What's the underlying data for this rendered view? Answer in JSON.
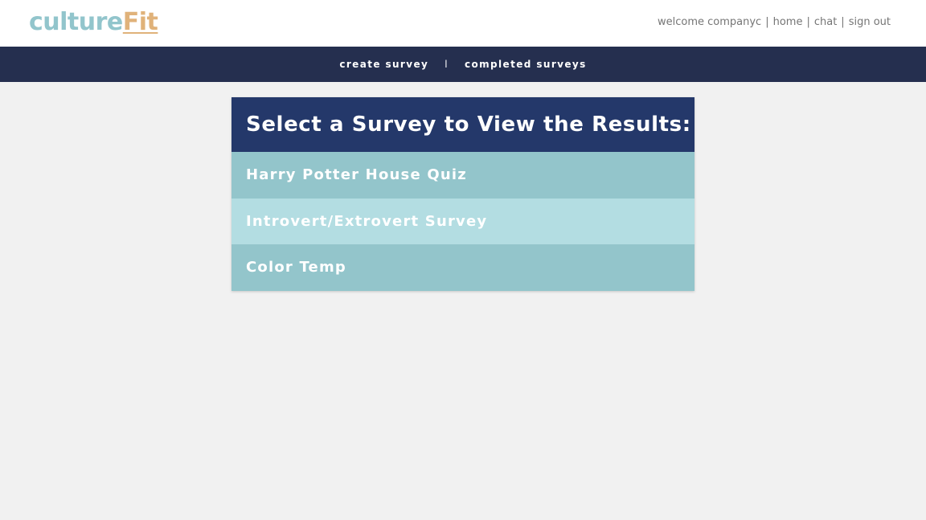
{
  "logo": {
    "part1": "culture",
    "part2": "Fit"
  },
  "user_nav": {
    "welcome": "welcome companyc",
    "home": "home",
    "chat": "chat",
    "sign_out": "sign out",
    "separator": "|"
  },
  "main_nav": {
    "create_survey": "create survey",
    "completed_surveys": "completed surveys",
    "divider": "l"
  },
  "panel": {
    "title": "Select a Survey to View the Results:",
    "surveys": [
      {
        "label": "Harry Potter House Quiz"
      },
      {
        "label": "Introvert/Extrovert Survey"
      },
      {
        "label": "Color Temp"
      }
    ]
  },
  "colors": {
    "logo_culture": "#92c5cc",
    "logo_fit": "#e0b27a",
    "navbar_bg": "#252f4f",
    "panel_header_bg": "#24386a",
    "row_dark": "#93c5cb",
    "row_light": "#b3dde2",
    "page_bg": "#f1f1f1"
  }
}
